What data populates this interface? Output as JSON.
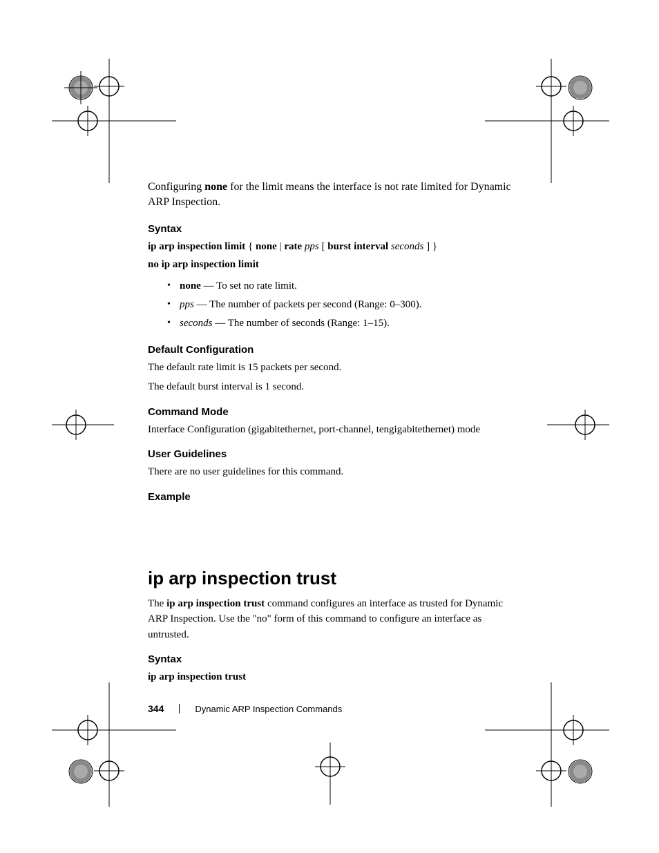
{
  "intro": {
    "prefix": "Configuring ",
    "bold": "none",
    "suffix": " for the limit means the interface is not rate limited for Dynamic ARP Inspection."
  },
  "section1": {
    "heading": "Syntax",
    "line1": {
      "t1": "ip arp inspection limit",
      "t2": " { ",
      "t3": "none",
      "t4": " | ",
      "t5": "rate",
      "t6": " ",
      "t7": "pps",
      "t8": " [ ",
      "t9": "burst interval",
      "t10": " ",
      "t11": "seconds",
      "t12": " ] }"
    },
    "line2": "no ip arp inspection limit",
    "bullets": [
      {
        "term": "none",
        "desc": " — To set no rate limit."
      },
      {
        "term": "pps",
        "desc": " — The number of packets per second (Range: 0–300)."
      },
      {
        "term": "seconds",
        "desc": " — The number of seconds (Range: 1–15)."
      }
    ]
  },
  "section2": {
    "heading": "Default Configuration",
    "line1": "The default rate limit is 15 packets per second.",
    "line2": "The default burst interval is 1 second."
  },
  "section3": {
    "heading": "Command Mode",
    "text": "Interface Configuration (gigabitethernet, port-channel, tengigabitethernet) mode"
  },
  "section4": {
    "heading": "User Guidelines",
    "text": "There are no user guidelines for this command."
  },
  "section5": {
    "heading": "Example"
  },
  "command2": {
    "title": "ip arp inspection trust",
    "desc": {
      "prefix": "The ",
      "bold": "ip arp inspection trust",
      "suffix": " command configures an interface as trusted for Dynamic ARP Inspection. Use the \"no\" form of this command to configure an interface as untrusted."
    },
    "syntax": {
      "heading": "Syntax",
      "line": "ip arp inspection trust"
    }
  },
  "footer": {
    "page": "344",
    "chapter": "Dynamic ARP Inspection Commands"
  }
}
